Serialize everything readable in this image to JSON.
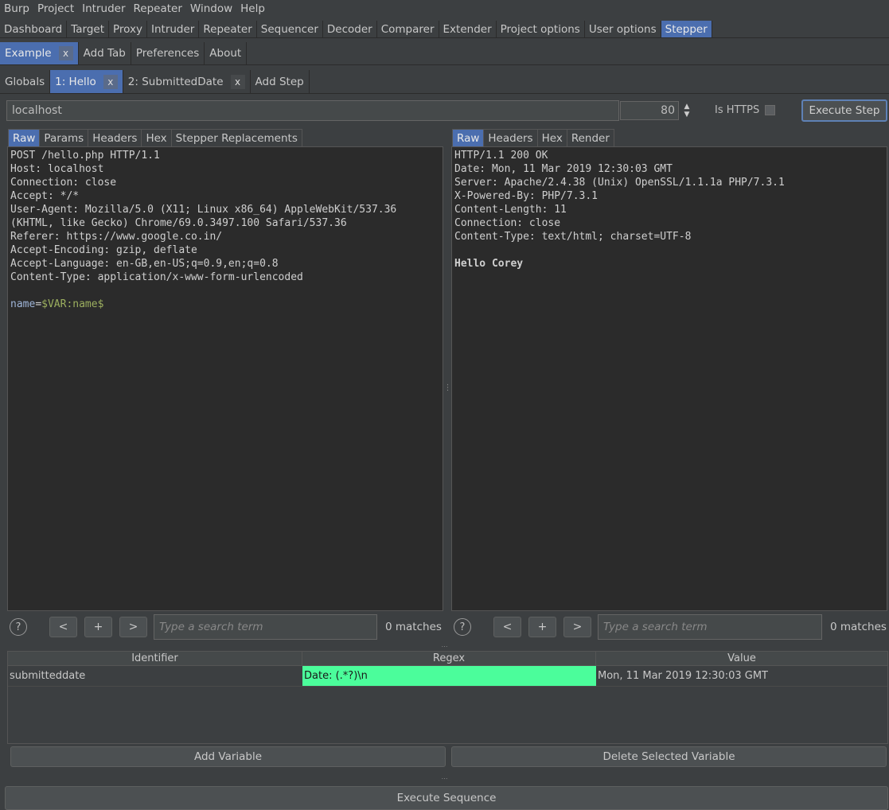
{
  "menu": [
    "Burp",
    "Project",
    "Intruder",
    "Repeater",
    "Window",
    "Help"
  ],
  "top_tabs": [
    "Dashboard",
    "Target",
    "Proxy",
    "Intruder",
    "Repeater",
    "Sequencer",
    "Decoder",
    "Comparer",
    "Extender",
    "Project options",
    "User options",
    "Stepper"
  ],
  "sub_tabs": {
    "example": "Example",
    "close": "x",
    "add_tab": "Add Tab",
    "preferences": "Preferences",
    "about": "About"
  },
  "step_tabs": {
    "globals": "Globals",
    "step1": "1: Hello",
    "step2": "2: SubmittedDate",
    "close": "x",
    "add_step": "Add Step"
  },
  "target": {
    "host": "localhost",
    "port": "80",
    "https_label": "Is HTTPS",
    "execute_step": "Execute Step"
  },
  "request_tabs": [
    "Raw",
    "Params",
    "Headers",
    "Hex",
    "Stepper Replacements"
  ],
  "response_tabs": [
    "Raw",
    "Headers",
    "Hex",
    "Render"
  ],
  "request": {
    "lines": [
      "POST /hello.php HTTP/1.1",
      "Host: localhost",
      "Connection: close",
      "Accept: */*",
      "User-Agent: Mozilla/5.0 (X11; Linux x86_64) AppleWebKit/537.36",
      "(KHTML, like Gecko) Chrome/69.0.3497.100 Safari/537.36",
      "Referer: https://www.google.co.in/",
      "Accept-Encoding: gzip, deflate",
      "Accept-Language: en-GB,en-US;q=0.9,en;q=0.8",
      "Content-Type: application/x-www-form-urlencoded"
    ],
    "body_name": "name",
    "body_eq": "=",
    "body_var": "$VAR:name$"
  },
  "response": {
    "lines": [
      "HTTP/1.1 200 OK",
      "Date: Mon, 11 Mar 2019 12:30:03 GMT",
      "Server: Apache/2.4.38 (Unix) OpenSSL/1.1.1a PHP/7.3.1",
      "X-Powered-By: PHP/7.3.1",
      "Content-Length: 11",
      "Connection: close",
      "Content-Type: text/html; charset=UTF-8"
    ],
    "body": "Hello Corey"
  },
  "search": {
    "help": "?",
    "prev": "<",
    "add": "+",
    "next": ">",
    "placeholder": "Type a search term",
    "matches": "0 matches"
  },
  "variables": {
    "headers": [
      "Identifier",
      "Regex",
      "Value"
    ],
    "rows": [
      {
        "identifier": "submitteddate",
        "regex": "Date: (.*?)\\n",
        "value": "Mon, 11 Mar 2019 12:30:03 GMT"
      }
    ],
    "add_label": "Add Variable",
    "delete_label": "Delete Selected Variable"
  },
  "execute_sequence": "Execute Sequence",
  "colors": {
    "selected_tab": "#4b6eaf",
    "regex_highlight": "#4bfd9b",
    "background": "#3c3f41",
    "editor_bg": "#2b2b2b"
  }
}
